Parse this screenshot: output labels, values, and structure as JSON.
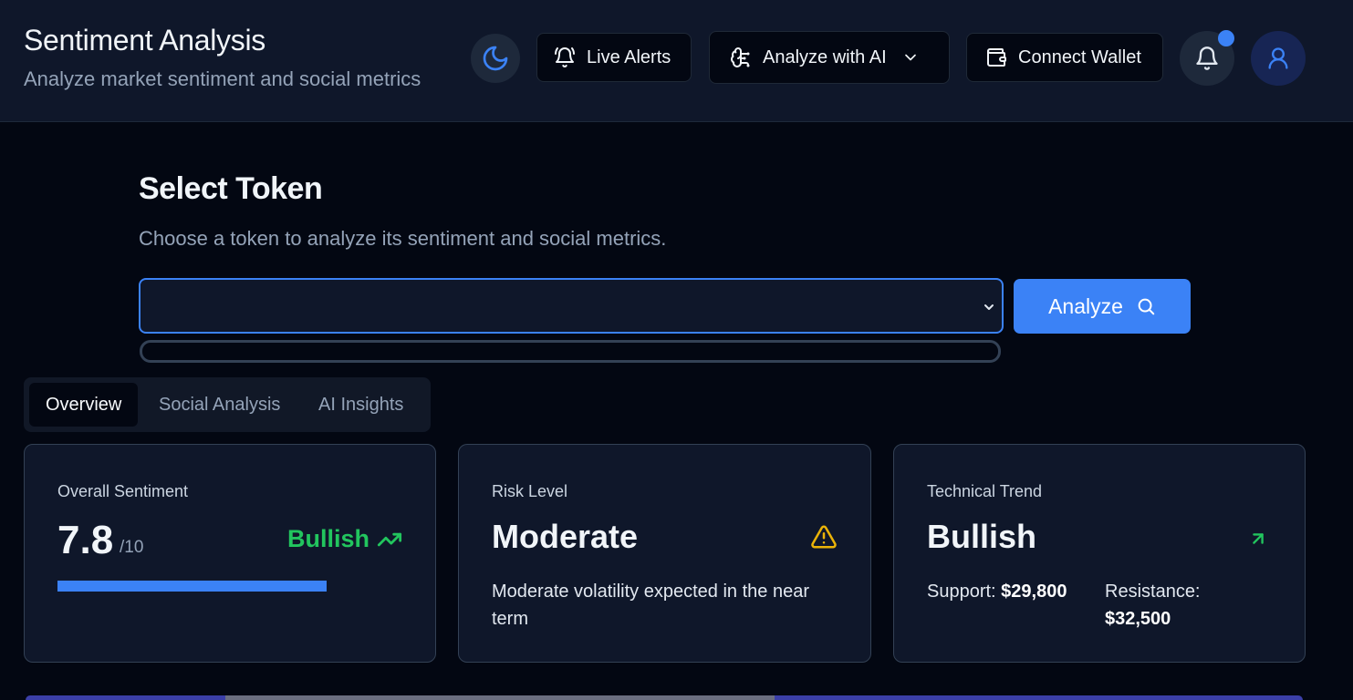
{
  "header": {
    "title": "Sentiment Analysis",
    "subtitle": "Analyze market sentiment and social metrics",
    "live_alerts_label": "Live Alerts",
    "analyze_ai_label": "Analyze with AI",
    "connect_wallet_label": "Connect Wallet"
  },
  "token_section": {
    "title": "Select Token",
    "description": "Choose a token to analyze its sentiment and social metrics.",
    "selected_token": "",
    "analyze_label": "Analyze"
  },
  "tabs": [
    {
      "label": "Overview",
      "active": true
    },
    {
      "label": "Social Analysis",
      "active": false
    },
    {
      "label": "AI Insights",
      "active": false
    }
  ],
  "cards": {
    "sentiment": {
      "label": "Overall Sentiment",
      "score": "7.8",
      "max": "/10",
      "status": "Bullish",
      "progress_fraction": 0.78
    },
    "risk": {
      "label": "Risk Level",
      "value": "Moderate",
      "description": "Moderate volatility expected in the near term"
    },
    "trend": {
      "label": "Technical Trend",
      "value": "Bullish",
      "support_label": "Support:",
      "support_value": "$29,800",
      "resistance_label": "Resistance:",
      "resistance_value": "$32,500"
    }
  },
  "icons": {
    "theme": "moon-icon",
    "live_alerts": "bell-ring-icon",
    "analyze_ai": "brain-icon",
    "wallet": "wallet-icon",
    "notifications": "bell-icon",
    "user": "user-icon",
    "analyze": "search-icon",
    "sentiment_status": "trending-up-icon",
    "risk": "warning-triangle-icon",
    "trend": "arrow-up-right-icon"
  },
  "colors": {
    "accent": "#3b82f6",
    "bullish": "#22c55e",
    "warning": "#eab308",
    "background": "#030712",
    "card": "#0f172a"
  }
}
